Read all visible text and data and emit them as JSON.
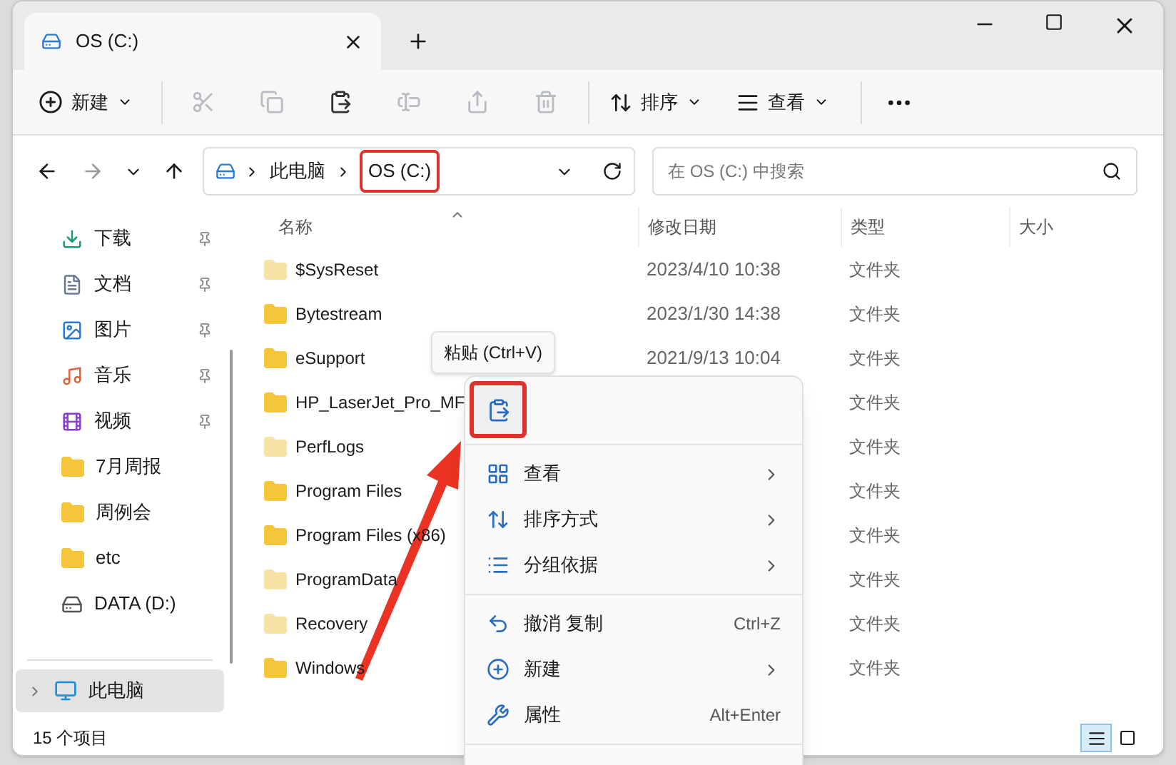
{
  "window": {
    "tab_title": "OS (C:)"
  },
  "toolbar": {
    "new_label": "新建",
    "sort_label": "排序",
    "view_label": "查看",
    "icon_buttons": [
      {
        "kind": "cut",
        "disabled": true
      },
      {
        "kind": "copy",
        "disabled": true
      },
      {
        "kind": "paste",
        "disabled": false
      },
      {
        "kind": "rename",
        "disabled": true
      },
      {
        "kind": "share",
        "disabled": true
      },
      {
        "kind": "delete",
        "disabled": true
      }
    ]
  },
  "address": {
    "path": [
      {
        "label": "此电脑",
        "annotated": false
      },
      {
        "label": "OS (C:)",
        "annotated": true
      }
    ]
  },
  "search": {
    "placeholder": "在 OS (C:) 中搜索"
  },
  "sidebar": {
    "items": [
      {
        "label": "下载",
        "kind": "download",
        "pinned": true
      },
      {
        "label": "文档",
        "kind": "document",
        "pinned": true
      },
      {
        "label": "图片",
        "kind": "picture",
        "pinned": true
      },
      {
        "label": "音乐",
        "kind": "music",
        "pinned": true
      },
      {
        "label": "视频",
        "kind": "video",
        "pinned": true
      },
      {
        "label": "7月周报",
        "kind": "folder",
        "pinned": false
      },
      {
        "label": "周例会",
        "kind": "folder",
        "pinned": false
      },
      {
        "label": "etc",
        "kind": "folder",
        "pinned": false
      },
      {
        "label": "DATA (D:)",
        "kind": "drive",
        "pinned": false
      }
    ],
    "this_pc": {
      "label": "此电脑",
      "selected": true
    }
  },
  "columns": [
    "名称",
    "修改日期",
    "类型",
    "大小"
  ],
  "rows": [
    {
      "name": "$SysReset",
      "modified": "2023/4/10 10:38",
      "type": "文件夹",
      "hidden": true
    },
    {
      "name": "Bytestream",
      "modified": "2023/1/30 14:38",
      "type": "文件夹",
      "hidden": false
    },
    {
      "name": "eSupport",
      "modified": "2021/9/13 10:04",
      "type": "文件夹",
      "hidden": false
    },
    {
      "name": "HP_LaserJet_Pro_MF",
      "type": "文件夹",
      "hidden": false
    },
    {
      "name": "PerfLogs",
      "type": "文件夹",
      "hidden": true
    },
    {
      "name": "Program Files",
      "type": "文件夹",
      "hidden": false
    },
    {
      "name": "Program Files (x86)",
      "type": "文件夹",
      "hidden": false
    },
    {
      "name": "ProgramData",
      "type": "文件夹",
      "hidden": true
    },
    {
      "name": "Recovery",
      "type": "文件夹",
      "hidden": true
    },
    {
      "name": "Windows",
      "type": "文件夹",
      "hidden": false
    }
  ],
  "tooltip": "粘贴 (Ctrl+V)",
  "context_menu": {
    "items": [
      {
        "kind": "paste",
        "annotated": true
      },
      {
        "kind": "separator"
      },
      {
        "kind": "view",
        "label": "查看",
        "submenu": true
      },
      {
        "kind": "sort",
        "label": "排序方式",
        "submenu": true
      },
      {
        "kind": "group",
        "label": "分组依据",
        "submenu": true
      },
      {
        "kind": "separator"
      },
      {
        "kind": "undo",
        "label": "撤消 复制",
        "shortcut": "Ctrl+Z",
        "submenu": false
      },
      {
        "kind": "new",
        "label": "新建",
        "submenu": true
      },
      {
        "kind": "properties",
        "label": "属性",
        "shortcut": "Alt+Enter",
        "submenu": false
      },
      {
        "kind": "separator"
      }
    ]
  },
  "status_bar": {
    "count": "15 个项目"
  },
  "view_buttons": [
    {
      "kind": "details",
      "selected": true
    },
    {
      "kind": "tiles",
      "selected": false
    }
  ]
}
